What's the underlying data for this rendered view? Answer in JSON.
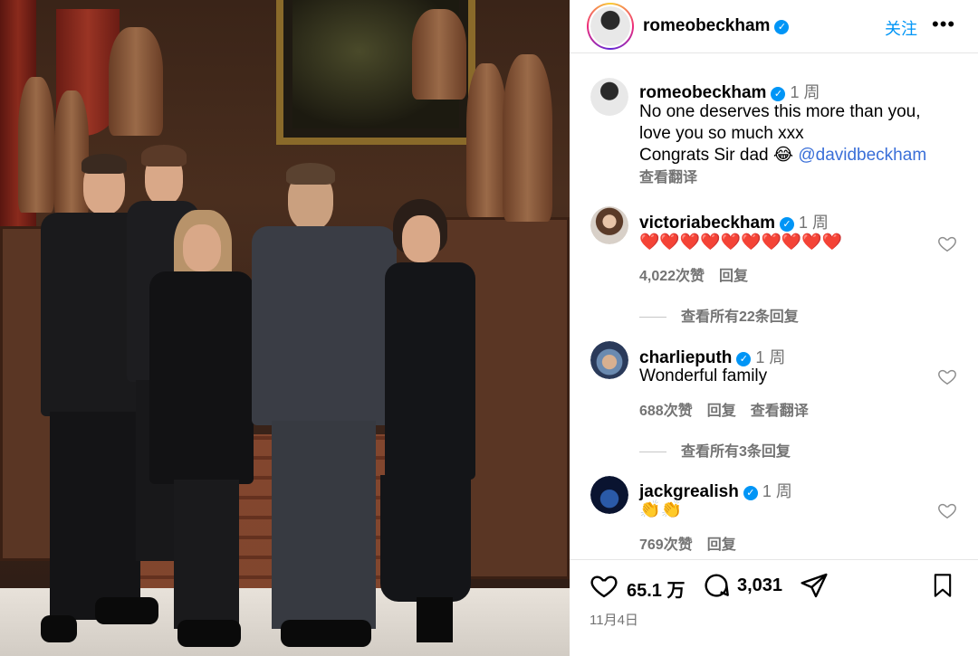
{
  "post": {
    "username": "romeobeckham",
    "follow_label": "关注",
    "more_label": "•••"
  },
  "caption": {
    "username": "romeobeckham",
    "time": "1 周",
    "line1": "No one deserves this more than you,",
    "line2": "love you so much xxx",
    "line3_prefix": "Congrats Sir dad 😂 ",
    "mention": "@davidbeckham",
    "translate": "查看翻译"
  },
  "comments": [
    {
      "username": "victoriabeckham",
      "time": "1 周",
      "text": "❤️❤️❤️❤️❤️❤️❤️❤️❤️❤️",
      "likes": "4,022次赞",
      "reply": "回复",
      "view_replies": "查看所有22条回复"
    },
    {
      "username": "charlieputh",
      "time": "1 周",
      "text": "Wonderful family",
      "likes": "688次赞",
      "reply": "回复",
      "translate": "查看翻译",
      "view_replies": "查看所有3条回复"
    },
    {
      "username": "jackgrealish",
      "time": "1 周",
      "text": "👏👏",
      "likes": "769次赞",
      "reply": "回复"
    }
  ],
  "actions": {
    "like_count": "65.1 万",
    "comment_count": "3,031",
    "date": "11月4日"
  },
  "colors": {
    "verified": "#0095f6",
    "link": "#0095f6",
    "muted": "#737373"
  }
}
